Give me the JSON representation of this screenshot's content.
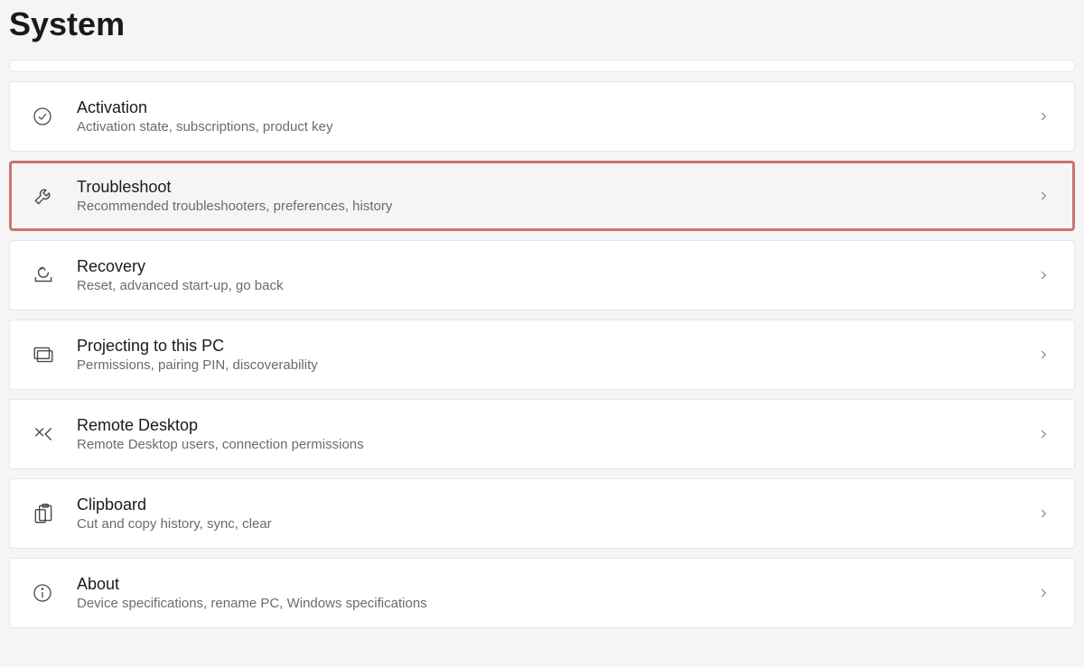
{
  "page": {
    "title": "System"
  },
  "items": [
    {
      "id": "activation",
      "title": "Activation",
      "subtitle": "Activation state, subscriptions, product key",
      "icon": "check-circle-icon",
      "highlighted": false
    },
    {
      "id": "troubleshoot",
      "title": "Troubleshoot",
      "subtitle": "Recommended troubleshooters, preferences, history",
      "icon": "wrench-icon",
      "highlighted": true
    },
    {
      "id": "recovery",
      "title": "Recovery",
      "subtitle": "Reset, advanced start-up, go back",
      "icon": "recovery-icon",
      "highlighted": false
    },
    {
      "id": "projecting",
      "title": "Projecting to this PC",
      "subtitle": "Permissions, pairing PIN, discoverability",
      "icon": "project-icon",
      "highlighted": false
    },
    {
      "id": "remote-desktop",
      "title": "Remote Desktop",
      "subtitle": "Remote Desktop users, connection permissions",
      "icon": "remote-icon",
      "highlighted": false
    },
    {
      "id": "clipboard",
      "title": "Clipboard",
      "subtitle": "Cut and copy history, sync, clear",
      "icon": "clipboard-icon",
      "highlighted": false
    },
    {
      "id": "about",
      "title": "About",
      "subtitle": "Device specifications, rename PC, Windows specifications",
      "icon": "info-icon",
      "highlighted": false
    }
  ]
}
